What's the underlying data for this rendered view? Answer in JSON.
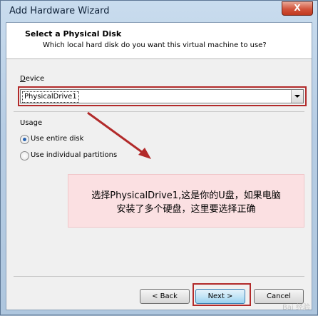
{
  "window": {
    "title": "Add Hardware Wizard",
    "close_glyph": "X"
  },
  "header": {
    "title": "Select a Physical Disk",
    "subtitle": "Which local hard disk do you want this virtual machine to use?"
  },
  "device": {
    "label": "Device",
    "selected": "PhysicalDrive1"
  },
  "usage": {
    "label": "Usage",
    "options": [
      {
        "label": "Use entire disk",
        "selected": true
      },
      {
        "label": "Use individual partitions",
        "selected": false
      }
    ]
  },
  "annotation": {
    "line1": "选择PhysicalDrive1,这是你的U盘，如果电脑",
    "line2": "安装了多个硬盘，这里要选择正确",
    "color": "#b22a2a"
  },
  "buttons": {
    "back": "< Back",
    "next": "Next >",
    "cancel": "Cancel"
  },
  "watermark": "Bai 经验"
}
